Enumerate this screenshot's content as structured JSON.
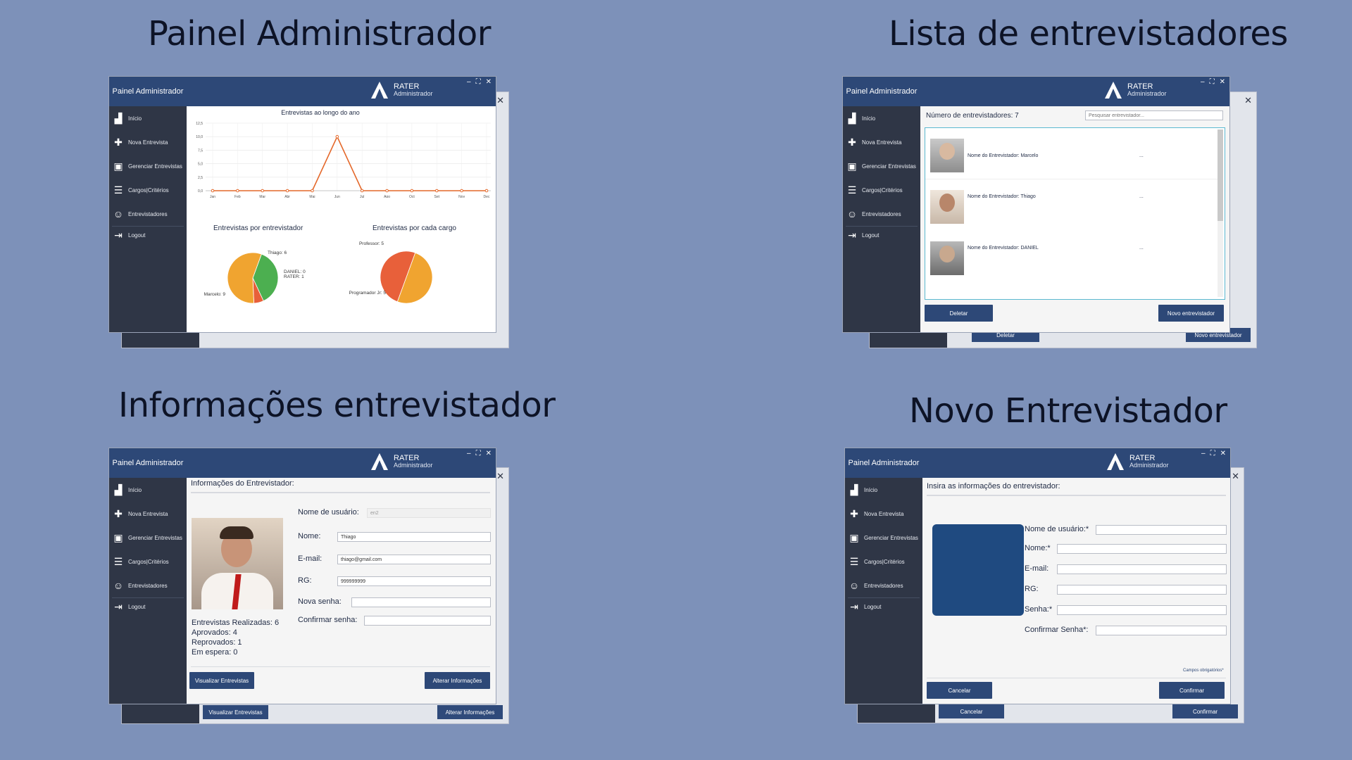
{
  "titles": {
    "q1": "Painel Administrador",
    "q2": "Lista de entrevistadores",
    "q3": "Informações entrevistador",
    "q4": "Novo Entrevistador"
  },
  "app": {
    "brand": "Painel Administrador",
    "logo_name": "RATER",
    "logo_sub": "Administrador",
    "controls": [
      "–",
      "⛶",
      "✕"
    ]
  },
  "sidebar": {
    "items": [
      {
        "label": "Início",
        "icon": "chart-icon"
      },
      {
        "label": "Nova Entrevista",
        "icon": "add-document-icon"
      },
      {
        "label": "Gerenciar Entrevistas",
        "icon": "manage-document-icon"
      },
      {
        "label": "Cargos|Critérios",
        "icon": "checklist-icon"
      },
      {
        "label": "Entrevistadores",
        "icon": "users-icon"
      },
      {
        "label": "Logout",
        "icon": "logout-icon"
      }
    ]
  },
  "dashboard": {
    "line_title": "Entrevistas ao longo do ano",
    "pie1_title": "Entrevistas  por entrevistador",
    "pie2_title": "Entrevistas por cada cargo"
  },
  "chart_data": [
    {
      "type": "line",
      "title": "Entrevistas ao longo do ano",
      "categories": [
        "Jan",
        "Feb",
        "Mar",
        "Abr",
        "Mai",
        "Jun",
        "Jul",
        "Ago",
        "Oct",
        "Set",
        "Nov",
        "Dec"
      ],
      "values": [
        0,
        0,
        0,
        0,
        0,
        10,
        0,
        0,
        0,
        0,
        0,
        0
      ],
      "yticks": [
        "0,0",
        "2,5",
        "5,0",
        "7,5",
        "10,0",
        "12,5"
      ],
      "ylim": [
        0,
        12.5
      ],
      "color": "#e4682a"
    },
    {
      "type": "pie",
      "title": "Entrevistas  por entrevistador",
      "slices": [
        {
          "label": "Thiago: 6",
          "value": 6,
          "color": "#4caf50"
        },
        {
          "label": "DANIEL: 0",
          "value": 0,
          "color": "#e8503a"
        },
        {
          "label": "RATER: 1",
          "value": 1,
          "color": "#e8603a"
        },
        {
          "label": "Marcelo: 9",
          "value": 9,
          "color": "#f0a430"
        }
      ]
    },
    {
      "type": "pie",
      "title": "Entrevistas por cada cargo",
      "slices": [
        {
          "label": "Professor: 5",
          "value": 5,
          "color": "#f0a430"
        },
        {
          "label": "Programador Jr: 5",
          "value": 5,
          "color": "#e8603a"
        }
      ]
    }
  ],
  "list": {
    "count_label": "Número de entrevistadores: 7",
    "search_placeholder": "Pesquisar entrevistador...",
    "rows": [
      {
        "name": "Nome do Entrevistador: Marcelo",
        "more": "..."
      },
      {
        "name": "Nome do Entrevistador: Thiago",
        "more": "..."
      },
      {
        "name": "Nome do Entrevistador: DANIEL",
        "more": "..."
      }
    ],
    "delete_label": "Deletar",
    "new_label": "Novo entrevistador"
  },
  "info": {
    "header": "Informações do Entrevistador:",
    "username_label": "Nome de usuário:",
    "username_value": "en2",
    "name_label": "Nome:",
    "name_value": "Thiago",
    "email_label": "E-mail:",
    "email_value": "thiago@gmail.com",
    "rg_label": "RG:",
    "rg_value": "999999999",
    "newpass_label": "Nova senha:",
    "confirm_label": "Confirmar senha:",
    "stats": [
      "Entrevistas Realizadas: 6",
      "Aprovados: 4",
      "Reprovados: 1",
      "Em espera: 0"
    ],
    "view_label": "Visualizar Entrevistas",
    "edit_label": "Alterar Informações"
  },
  "newform": {
    "header": "Insira as informações do entrevistador:",
    "username_label": "Nome de usuário:*",
    "name_label": "Nome:*",
    "email_label": "E-mail:",
    "rg_label": "RG:",
    "pass_label": "Senha:*",
    "confirm_label": "Confirmar Senha*:",
    "required_note": "Campos obrigatórios*",
    "cancel_label": "Cancelar",
    "confirm_btn": "Confirmar"
  }
}
